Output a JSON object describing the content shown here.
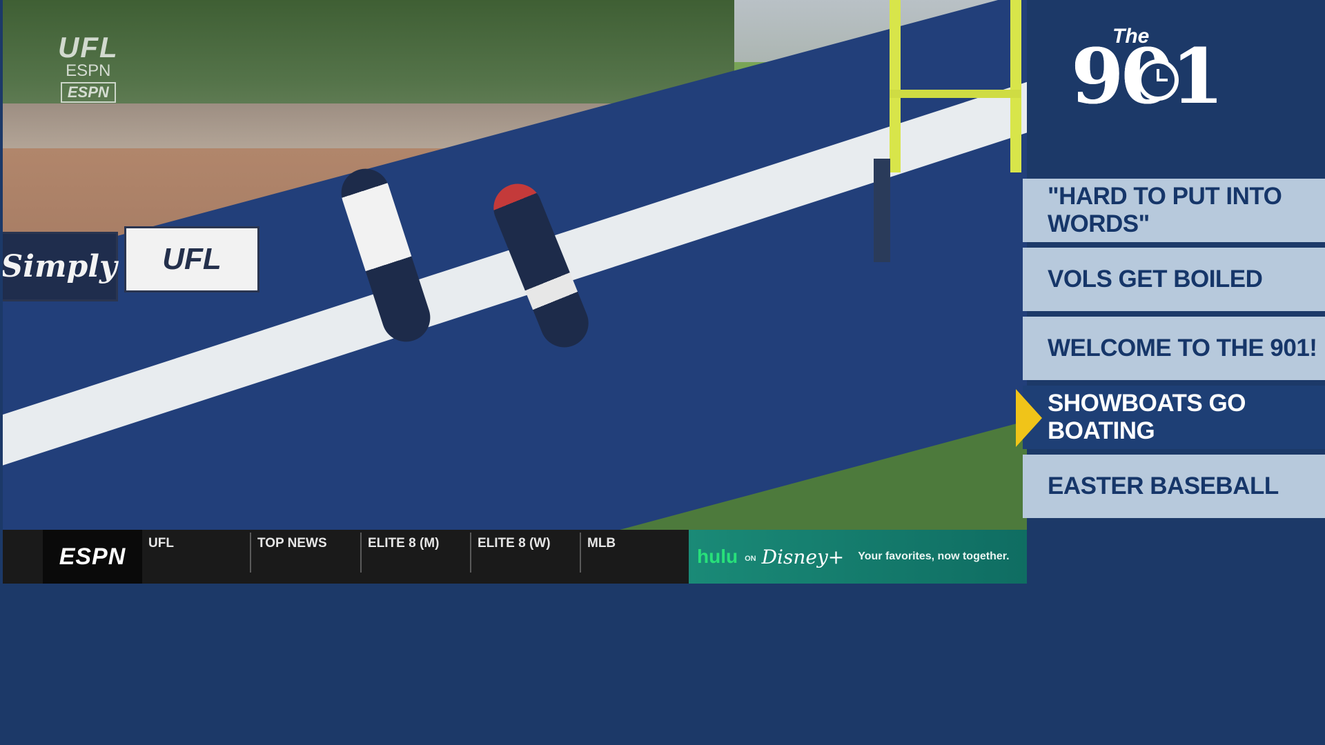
{
  "broadcast": {
    "watermark": {
      "league": "UFL",
      "network": "ESPN",
      "network_bug": "ESPN"
    },
    "field_signage": {
      "left_sign": "Simply",
      "center_sign": "UFL"
    }
  },
  "ticker": {
    "network_logo": "ESPN",
    "items": [
      "UFL",
      "TOP NEWS",
      "ELITE 8 (M)",
      "ELITE 8 (W)",
      "MLB"
    ],
    "ad": {
      "brand1": "hulu",
      "joiner": "ON",
      "brand2": "Disney+",
      "tagline": "Your favorites, now together."
    }
  },
  "show": {
    "prefix": "The",
    "name": "901"
  },
  "rundown": {
    "items": [
      {
        "label": "\"HARD TO PUT INTO WORDS\"",
        "active": false
      },
      {
        "label": "VOLS GET BOILED",
        "active": false
      },
      {
        "label": "WELCOME TO THE 901!",
        "active": false
      },
      {
        "label": "SHOWBOATS GO BOATING",
        "active": true
      },
      {
        "label": "EASTER BASEBALL",
        "active": false
      }
    ],
    "colors": {
      "item_bg": "#b7c9dc",
      "active_bg": "#1e3f75",
      "marker": "#f0c419",
      "panel_bg": "#1c3968"
    }
  }
}
